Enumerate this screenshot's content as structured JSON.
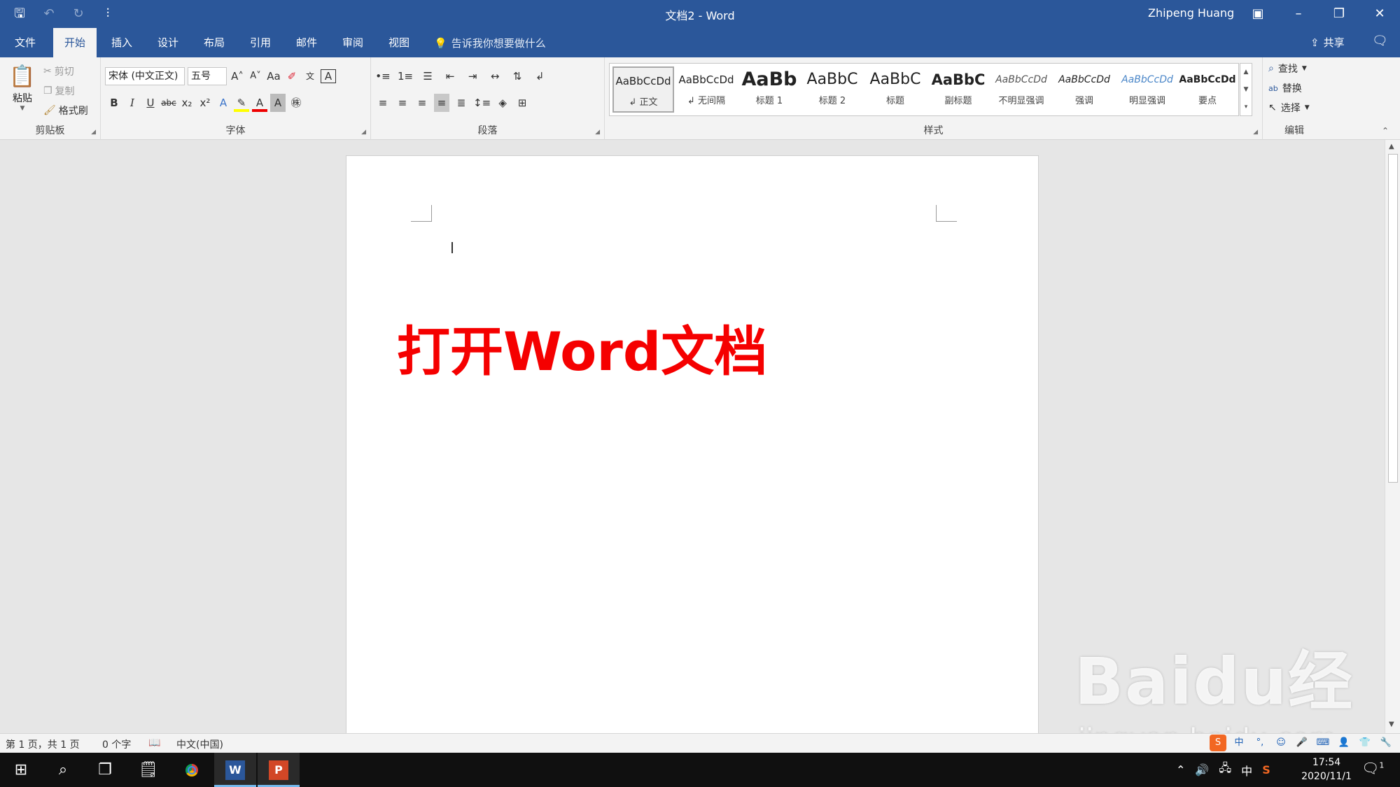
{
  "window": {
    "title": "文档2  -  Word",
    "user": "Zhipeng Huang"
  },
  "tabs": [
    "文件",
    "开始",
    "插入",
    "设计",
    "布局",
    "引用",
    "邮件",
    "审阅",
    "视图"
  ],
  "active_tab": "开始",
  "tell_me": "告诉我你想要做什么",
  "share": "共享",
  "clipboard": {
    "label": "剪贴板",
    "paste": "粘贴",
    "cut": "剪切",
    "copy": "复制",
    "format_painter": "格式刷"
  },
  "font": {
    "label": "字体",
    "name": "宋体 (中文正文)",
    "size": "五号",
    "case": "Aa"
  },
  "paragraph": {
    "label": "段落"
  },
  "styles": {
    "label": "样式",
    "items": [
      {
        "preview": "AaBbCcDd",
        "name": "↲ 正文"
      },
      {
        "preview": "AaBbCcDd",
        "name": "↲ 无间隔"
      },
      {
        "preview": "AaBb",
        "name": "标题 1"
      },
      {
        "preview": "AaBbC",
        "name": "标题 2"
      },
      {
        "preview": "AaBbC",
        "name": "标题"
      },
      {
        "preview": "AaBbC",
        "name": "副标题"
      },
      {
        "preview": "AaBbCcDd",
        "name": "不明显强调"
      },
      {
        "preview": "AaBbCcDd",
        "name": "强调"
      },
      {
        "preview": "AaBbCcDd",
        "name": "明显强调"
      },
      {
        "preview": "AaBbCcDd",
        "name": "要点"
      }
    ]
  },
  "editing": {
    "label": "编辑",
    "find": "查找",
    "replace": "替换",
    "select": "选择"
  },
  "document": {
    "text": "打开Word文档",
    "text_color": "#f50000"
  },
  "status": {
    "page": "第 1 页，共 1 页",
    "words": "0 个字",
    "language": "中文(中国)"
  },
  "watermark": {
    "brand": "Bai",
    "brand2": "du",
    "cn": "经验",
    "url": "jingyan.baidu.com"
  },
  "taskbar": {
    "time": "17:54",
    "date": "2020/11/1",
    "ime": "中",
    "notif_count": "1"
  },
  "colors": {
    "accent": "#2b579a",
    "ribbon": "#f3f3f3",
    "workspace": "#e6e6e6"
  }
}
